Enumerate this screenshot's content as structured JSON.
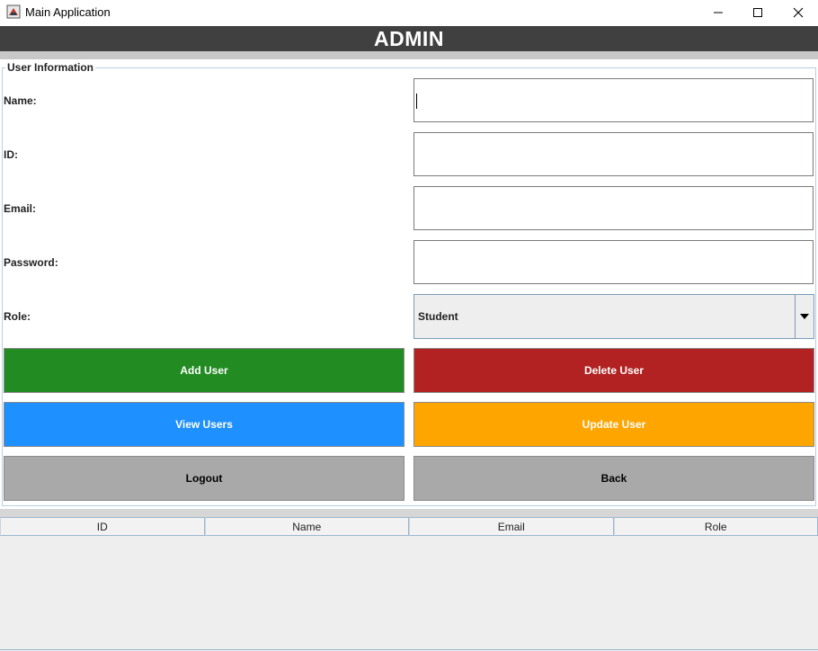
{
  "window": {
    "title": "Main Application",
    "icon": "java-app-icon",
    "controls": [
      "minimize-icon",
      "maximize-icon",
      "close-icon"
    ]
  },
  "header": {
    "title": "ADMIN",
    "background": "#404040"
  },
  "form": {
    "legend": "User Information",
    "labels": {
      "name": "Name:",
      "id": "ID:",
      "email": "Email:",
      "password": "Password:",
      "role": "Role:"
    },
    "values": {
      "name": "",
      "id": "",
      "email": "",
      "password": ""
    },
    "role": {
      "selected": "Student"
    }
  },
  "buttons": {
    "add_user": {
      "label": "Add User",
      "color": "#228B22"
    },
    "delete_user": {
      "label": "Delete User",
      "color": "#B22222"
    },
    "view_users": {
      "label": "View Users",
      "color": "#1E90FF"
    },
    "update_user": {
      "label": "Update User",
      "color": "#FFA500"
    },
    "logout": {
      "label": "Logout",
      "color": "#A9A9A9"
    },
    "back": {
      "label": "Back",
      "color": "#A9A9A9"
    }
  },
  "table": {
    "columns": [
      "ID",
      "Name",
      "Email",
      "Role"
    ],
    "rows": []
  }
}
